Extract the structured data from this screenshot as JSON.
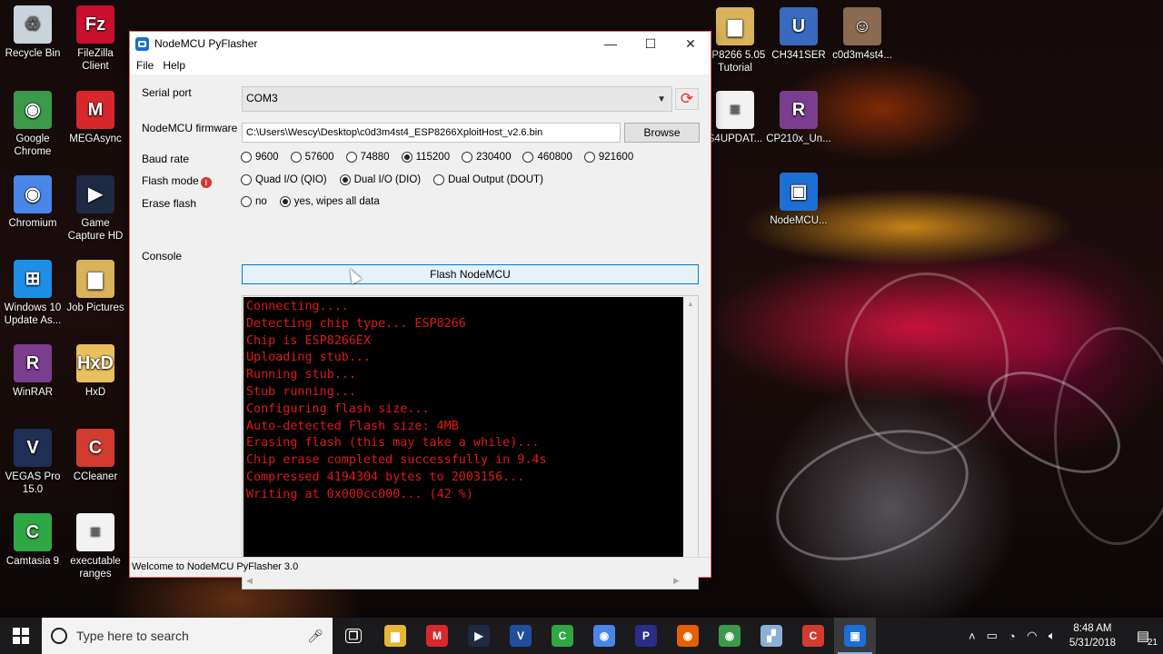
{
  "desktop": {
    "left_icons": [
      {
        "label": "Recycle Bin",
        "glyph": "recycle-bin-icon",
        "color": "#c9d3dc"
      },
      {
        "label": "FileZilla Client",
        "glyph": "filezilla-icon",
        "color": "#c8102e"
      },
      {
        "label": "Google Chrome",
        "glyph": "chrome-icon",
        "color": "#3b9a4a"
      },
      {
        "label": "MEGAsync",
        "glyph": "mega-icon",
        "color": "#d9272e"
      },
      {
        "label": "Chromium",
        "glyph": "chromium-icon",
        "color": "#4a86e8"
      },
      {
        "label": "Game Capture HD",
        "glyph": "game-capture-icon",
        "color": "#1e2a44"
      },
      {
        "label": "Windows 10 Update As...",
        "glyph": "windows-icon",
        "color": "#1e8fe6"
      },
      {
        "label": "Job Pictures",
        "glyph": "folder-icon",
        "color": "#d8b35a"
      },
      {
        "label": "WinRAR",
        "glyph": "winrar-icon",
        "color": "#7b3d8e"
      },
      {
        "label": "HxD",
        "glyph": "hxd-icon",
        "color": "#e8c060"
      },
      {
        "label": "VEGAS Pro 15.0",
        "glyph": "vegas-icon",
        "color": "#1d2f55"
      },
      {
        "label": "CCleaner",
        "glyph": "ccleaner-icon",
        "color": "#d23b2f"
      },
      {
        "label": "Camtasia 9",
        "glyph": "camtasia-icon",
        "color": "#2ea844"
      },
      {
        "label": "executable ranges",
        "glyph": "document-icon",
        "color": "#f2f2f2"
      }
    ],
    "right_icons": [
      {
        "label": "SP8266 5.05 Tutorial",
        "glyph": "folder-icon",
        "color": "#d8b35a"
      },
      {
        "label": "CH341SER",
        "glyph": "usb-driver-icon",
        "color": "#3a6ac0"
      },
      {
        "label": "c0d3m4st4...",
        "glyph": "portrait-icon",
        "color": "#8a6a50"
      },
      {
        "label": "S4UPDAT...",
        "glyph": "document-icon",
        "color": "#f2f2f2"
      },
      {
        "label": "CP210x_Un...",
        "glyph": "winrar-icon",
        "color": "#7b3d8e"
      },
      {
        "label": "NodeMCU...",
        "glyph": "nodemcu-icon",
        "color": "#1d6fd6"
      }
    ]
  },
  "window": {
    "title": "NodeMCU PyFlasher",
    "menu": [
      "File",
      "Help"
    ],
    "controls": {
      "minimize": "—",
      "maximize": "☐",
      "close": "✕"
    },
    "labels": {
      "serial_port": "Serial port",
      "firmware": "NodeMCU firmware",
      "baud_rate": "Baud rate",
      "flash_mode": "Flash mode",
      "erase_flash": "Erase flash",
      "console": "Console"
    },
    "serial_port_value": "COM3",
    "firmware_path": "C:\\Users\\Wescy\\Desktop\\c0d3m4st4_ESP8266XploitHost_v2.6.bin",
    "browse_label": "Browse",
    "baud_rates": [
      {
        "label": "9600",
        "selected": false
      },
      {
        "label": "57600",
        "selected": false
      },
      {
        "label": "74880",
        "selected": false
      },
      {
        "label": "115200",
        "selected": true
      },
      {
        "label": "230400",
        "selected": false
      },
      {
        "label": "460800",
        "selected": false
      },
      {
        "label": "921600",
        "selected": false
      }
    ],
    "flash_modes": [
      {
        "label": "Quad I/O (QIO)",
        "selected": false
      },
      {
        "label": "Dual I/O (DIO)",
        "selected": true
      },
      {
        "label": "Dual Output (DOUT)",
        "selected": false
      }
    ],
    "erase_options": [
      {
        "label": "no",
        "selected": false
      },
      {
        "label": "yes, wipes all data",
        "selected": true
      }
    ],
    "flash_button": "Flash NodeMCU",
    "console_lines": [
      "Connecting....",
      "Detecting chip type... ESP8266",
      "Chip is ESP8266EX",
      "Uploading stub...",
      "Running stub...",
      "Stub running...",
      "Configuring flash size...",
      "Auto-detected Flash size: 4MB",
      "Erasing flash (this may take a while)...",
      "Chip erase completed successfully in 9.4s",
      "Compressed 4194304 bytes to 2003156...",
      "Writing at 0x000cc000... (42 %)"
    ],
    "console_text_color": "#e01818",
    "status": "Welcome to NodeMCU PyFlasher 3.0"
  },
  "taskbar": {
    "search_placeholder": "Type here to search",
    "apps": [
      {
        "name": "task-view-icon",
        "color": "#1b1a1c",
        "active": false
      },
      {
        "name": "file-explorer-icon",
        "color": "#e8b632",
        "active": false
      },
      {
        "name": "mega-icon",
        "color": "#d9272e",
        "active": false
      },
      {
        "name": "game-capture-icon",
        "color": "#1e2a44",
        "active": false
      },
      {
        "name": "vegas-icon",
        "color": "#1d4f9c",
        "active": false
      },
      {
        "name": "camtasia-icon",
        "color": "#2ea844",
        "active": false
      },
      {
        "name": "chromium-icon",
        "color": "#4a86e8",
        "active": false
      },
      {
        "name": "playstation-icon",
        "color": "#2c2c8a",
        "active": false
      },
      {
        "name": "firefox-icon",
        "color": "#e66000",
        "active": false
      },
      {
        "name": "chrome-icon",
        "color": "#3b9a4a",
        "active": false
      },
      {
        "name": "paper-icon",
        "color": "#8ab0d8",
        "active": false
      },
      {
        "name": "ccleaner-icon",
        "color": "#d23b2f",
        "active": false
      },
      {
        "name": "nodemcu-icon",
        "color": "#1d6fd6",
        "active": true
      }
    ],
    "clock_time": "8:48 AM",
    "clock_date": "5/31/2018",
    "notification_count": "21"
  }
}
